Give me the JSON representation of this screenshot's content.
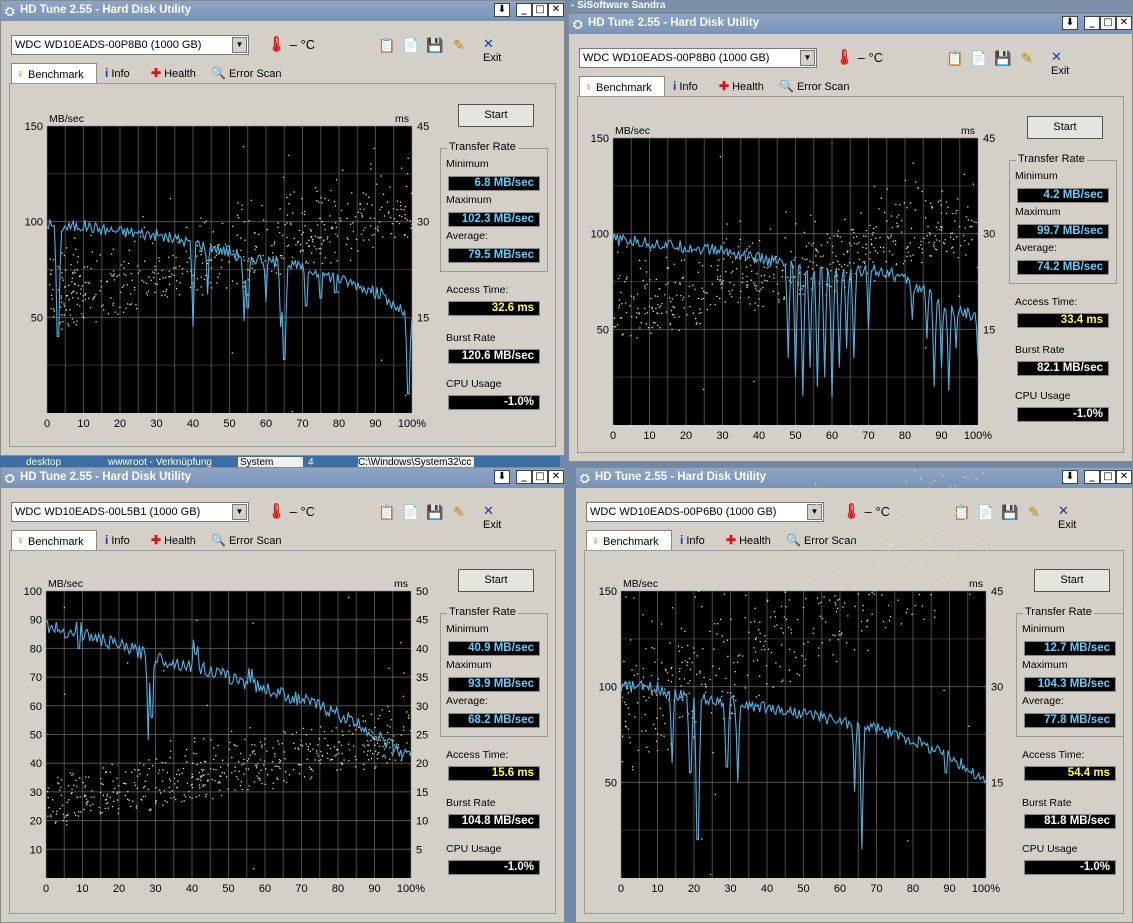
{
  "background": {
    "top_strip_text": "- SiSoftware Sandra",
    "taskbar_cells": [
      "desktop",
      "wwwroot - Verknüpfung",
      "System",
      "4",
      "C:\\Windows\\System32\\cc"
    ]
  },
  "common": {
    "title": "HD Tune 2.55 - Hard Disk Utility",
    "temperature": "– °C",
    "exit_label": "Exit",
    "tabs": [
      "Benchmark",
      "Info",
      "Health",
      "Error Scan"
    ],
    "start_label": "Start",
    "y_unit": "MB/sec",
    "y2_unit": "ms",
    "transfer_rate_label": "Transfer Rate",
    "minimum_label": "Minimum",
    "maximum_label": "Maximum",
    "average_label": "Average:",
    "access_time_label": "Access Time:",
    "burst_rate_label": "Burst Rate",
    "cpu_usage_label": "CPU Usage",
    "x_ticks": [
      "0",
      "10",
      "20",
      "30",
      "40",
      "50",
      "60",
      "70",
      "80",
      "90",
      "100%"
    ],
    "colors": {
      "chart_bg": "#000000",
      "grid": "#8a8a8a",
      "transfer_line": "#4fb4e8",
      "access_dots": "#e8e890",
      "value_cyan": "#5fd0ff",
      "value_yellow": "#ffff44",
      "value_white": "#ffffff"
    }
  },
  "windows": [
    {
      "drive": "WDC WD10EADS-00P8B0 (1000 GB)",
      "minimum": "6.8 MB/sec",
      "maximum": "102.3 MB/sec",
      "average": "79.5 MB/sec",
      "access_time": "32.6 ms",
      "burst_rate": "120.6 MB/sec",
      "cpu_usage": "-1.0%",
      "y_ticks": [
        "150",
        "100",
        "50"
      ],
      "y2_ticks": [
        "45",
        "30",
        "15"
      ],
      "chart_data": {
        "type": "line",
        "title": "",
        "xlabel": "",
        "ylabel": "MB/sec",
        "y2label": "ms",
        "xlim": [
          0,
          100
        ],
        "ylim": [
          0,
          150
        ],
        "y2lim": [
          0,
          45
        ],
        "x": [
          0,
          5,
          10,
          15,
          20,
          25,
          30,
          35,
          40,
          45,
          50,
          55,
          60,
          65,
          70,
          75,
          80,
          85,
          90,
          95,
          100
        ],
        "series": [
          {
            "values": [
              99,
              97,
              98,
              96,
              95,
              94,
              93,
              91,
              89,
              87,
              84,
              82,
              80,
              78,
              76,
              73,
              70,
              67,
              63,
              56,
              50
            ]
          }
        ],
        "dips": [
          [
            3,
            40
          ],
          [
            40,
            45
          ],
          [
            44,
            62
          ],
          [
            54,
            48
          ],
          [
            55,
            55
          ],
          [
            60,
            58
          ],
          [
            64,
            45
          ],
          [
            65,
            28
          ],
          [
            71,
            56
          ],
          [
            75,
            60
          ],
          [
            79,
            63
          ],
          [
            91,
            60
          ],
          [
            99,
            10
          ]
        ],
        "access_band": [
          12,
          24
        ]
      }
    },
    {
      "drive": "WDC WD10EADS-00P8B0 (1000 GB)",
      "minimum": "4.2 MB/sec",
      "maximum": "99.7 MB/sec",
      "average": "74.2 MB/sec",
      "access_time": "33.4 ms",
      "burst_rate": "82.1 MB/sec",
      "cpu_usage": "-1.0%",
      "y_ticks": [
        "150",
        "100",
        "50"
      ],
      "y2_ticks": [
        "45",
        "30",
        "15"
      ],
      "chart_data": {
        "type": "line",
        "title": "",
        "xlabel": "",
        "ylabel": "MB/sec",
        "y2label": "ms",
        "xlim": [
          0,
          100
        ],
        "ylim": [
          0,
          150
        ],
        "y2lim": [
          0,
          45
        ],
        "x": [
          0,
          5,
          10,
          15,
          20,
          25,
          30,
          35,
          40,
          45,
          50,
          55,
          60,
          65,
          70,
          75,
          80,
          85,
          90,
          95,
          100
        ],
        "series": [
          {
            "values": [
              97,
              96,
              95,
              94,
              93,
              92,
              91,
              89,
              87,
              85,
              82,
              80,
              79,
              79,
              82,
              80,
              76,
              70,
              64,
              60,
              56
            ]
          }
        ],
        "dips": [
          [
            48,
            35
          ],
          [
            50,
            25
          ],
          [
            52,
            15
          ],
          [
            54,
            30
          ],
          [
            56,
            20
          ],
          [
            58,
            25
          ],
          [
            60,
            14
          ],
          [
            62,
            30
          ],
          [
            64,
            40
          ],
          [
            66,
            35
          ],
          [
            70,
            50
          ],
          [
            82,
            55
          ],
          [
            86,
            45
          ],
          [
            88,
            20
          ],
          [
            90,
            30
          ],
          [
            92,
            18
          ],
          [
            94,
            40
          ],
          [
            100,
            35
          ]
        ],
        "access_band": [
          12,
          24
        ]
      }
    },
    {
      "drive": "WDC WD10EADS-00L5B1 (1000 GB)",
      "minimum": "40.9 MB/sec",
      "maximum": "93.9 MB/sec",
      "average": "68.2 MB/sec",
      "access_time": "15.6 ms",
      "burst_rate": "104.8 MB/sec",
      "cpu_usage": "-1.0%",
      "y_ticks": [
        "100",
        "90",
        "80",
        "70",
        "60",
        "50",
        "40",
        "30",
        "20",
        "10"
      ],
      "y2_ticks": [
        "50",
        "45",
        "40",
        "35",
        "30",
        "25",
        "20",
        "15",
        "10",
        "5"
      ],
      "chart_data": {
        "type": "line",
        "title": "",
        "xlabel": "",
        "ylabel": "MB/sec",
        "y2label": "ms",
        "xlim": [
          0,
          100
        ],
        "ylim": [
          0,
          100
        ],
        "y2lim": [
          0,
          50
        ],
        "x": [
          0,
          5,
          10,
          15,
          20,
          25,
          30,
          35,
          40,
          45,
          50,
          55,
          60,
          65,
          70,
          75,
          80,
          85,
          90,
          95,
          100
        ],
        "series": [
          {
            "values": [
              88,
              86,
              85,
              83,
              81,
              79,
              77,
              75,
              74,
              72,
              70,
              68,
              66,
              64,
              62,
              60,
              57,
              54,
              50,
              46,
              42
            ]
          }
        ],
        "dips": [
          [
            9,
            80
          ],
          [
            28,
            48
          ],
          [
            29,
            56
          ],
          [
            41,
            78
          ],
          [
            56,
            68
          ]
        ],
        "access_band": [
          8,
          18
        ]
      }
    },
    {
      "drive": "WDC WD10EADS-00P6B0 (1000 GB)",
      "minimum": "12.7 MB/sec",
      "maximum": "104.3 MB/sec",
      "average": "77.8 MB/sec",
      "access_time": "54.4 ms",
      "burst_rate": "81.8 MB/sec",
      "cpu_usage": "-1.0%",
      "y_ticks": [
        "150",
        "100",
        "50"
      ],
      "y2_ticks": [
        "45",
        "30",
        "15"
      ],
      "chart_data": {
        "type": "line",
        "title": "",
        "xlabel": "",
        "ylabel": "MB/sec",
        "y2label": "ms",
        "xlim": [
          0,
          100
        ],
        "ylim": [
          0,
          150
        ],
        "y2lim": [
          0,
          45
        ],
        "x": [
          0,
          5,
          10,
          15,
          20,
          25,
          30,
          35,
          40,
          45,
          50,
          55,
          60,
          65,
          70,
          75,
          80,
          85,
          90,
          95,
          100
        ],
        "series": [
          {
            "values": [
              100,
              100,
              99,
              96,
              94,
              93,
              92,
              90,
              89,
              87,
              86,
              84,
              82,
              80,
              78,
              75,
              72,
              68,
              64,
              57,
              50
            ]
          }
        ],
        "dips": [
          [
            14,
            60
          ],
          [
            19,
            55
          ],
          [
            21,
            20
          ],
          [
            29,
            58
          ],
          [
            32,
            50
          ],
          [
            64,
            45
          ],
          [
            66,
            15
          ],
          [
            89,
            55
          ]
        ],
        "access_band": [
          16,
          40
        ]
      }
    }
  ]
}
